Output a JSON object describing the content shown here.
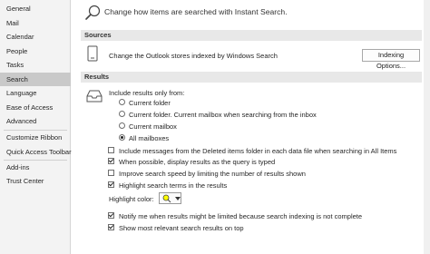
{
  "sidebar": {
    "items": [
      {
        "label": "General"
      },
      {
        "label": "Mail"
      },
      {
        "label": "Calendar"
      },
      {
        "label": "People"
      },
      {
        "label": "Tasks"
      },
      {
        "label": "Search",
        "active": true
      },
      {
        "label": "Language"
      },
      {
        "label": "Ease of Access"
      },
      {
        "label": "Advanced"
      },
      {
        "label": "Customize Ribbon"
      },
      {
        "label": "Quick Access Toolbar"
      },
      {
        "label": "Add-ins"
      },
      {
        "label": "Trust Center"
      }
    ]
  },
  "main": {
    "header_text": "Change how items are searched with Instant Search.",
    "sources": {
      "title": "Sources",
      "description": "Change the Outlook stores indexed by Windows Search",
      "button_label": "Indexing Options..."
    },
    "results": {
      "title": "Results",
      "include_label": "Include results only from:",
      "radio_options": [
        {
          "label": "Current folder",
          "selected": false
        },
        {
          "label": "Current folder. Current mailbox when searching from the inbox",
          "selected": false
        },
        {
          "label": "Current mailbox",
          "selected": false
        },
        {
          "label": "All mailboxes",
          "selected": true
        }
      ],
      "checkboxes": [
        {
          "label": "Include messages from the Deleted items folder in each data file when searching in All Items",
          "checked": false
        },
        {
          "label": "When possible, display results as the query is typed",
          "checked": true
        },
        {
          "label": "Improve search speed by limiting the number of results shown",
          "checked": false
        },
        {
          "label": "Highlight search terms in the results",
          "checked": true
        }
      ],
      "highlight_color_label": "Highlight color:",
      "highlight_color": "#ffff00",
      "bottom_checkboxes": [
        {
          "label": "Notify me when results might be limited because search indexing is not complete",
          "checked": true
        },
        {
          "label": "Show most relevant search results on top",
          "checked": true
        }
      ]
    }
  }
}
